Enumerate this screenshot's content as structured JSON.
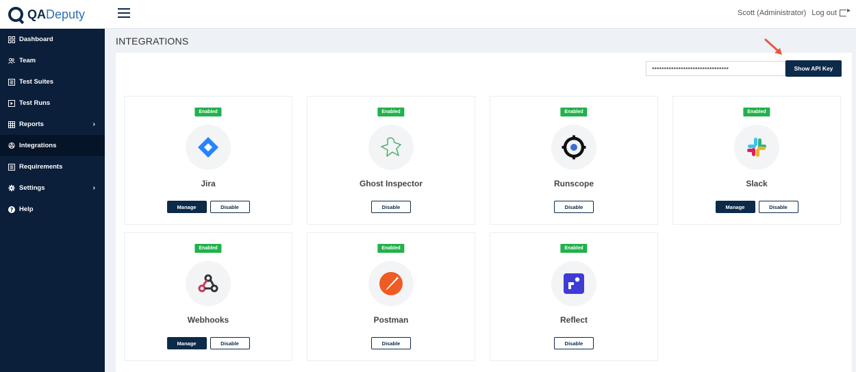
{
  "brand": {
    "name_bold": "QA",
    "name_regular": "Deputy"
  },
  "header": {
    "user_label": "Scott (Administrator)",
    "logout_label": "Log out"
  },
  "sidebar": {
    "items": [
      {
        "label": "Dashboard",
        "icon": "dashboard-grid-icon"
      },
      {
        "label": "Team",
        "icon": "team-icon"
      },
      {
        "label": "Test Suites",
        "icon": "list-icon"
      },
      {
        "label": "Test Runs",
        "icon": "play-icon"
      },
      {
        "label": "Reports",
        "icon": "table-icon",
        "has_chevron": true
      },
      {
        "label": "Integrations",
        "icon": "integrations-icon",
        "active": true
      },
      {
        "label": "Requirements",
        "icon": "list-icon"
      },
      {
        "label": "Settings",
        "icon": "gear-icon",
        "has_chevron": true
      },
      {
        "label": "Help",
        "icon": "help-icon"
      }
    ]
  },
  "main": {
    "title": "INTEGRATIONS",
    "api_key": {
      "masked_value": "••••••••••••••••••••••••••••••••",
      "button_label": "Show API Key"
    },
    "integrations": [
      {
        "name": "Jira",
        "status": "Enabled",
        "manage_label": "Manage",
        "disable_label": "Disable",
        "icon": "jira-icon"
      },
      {
        "name": "Ghost Inspector",
        "status": "Enabled",
        "disable_label": "Disable",
        "icon": "ghost-icon"
      },
      {
        "name": "Runscope",
        "status": "Enabled",
        "disable_label": "Disable",
        "icon": "runscope-icon"
      },
      {
        "name": "Slack",
        "status": "Enabled",
        "manage_label": "Manage",
        "disable_label": "Disable",
        "icon": "slack-icon"
      },
      {
        "name": "Webhooks",
        "status": "Enabled",
        "manage_label": "Manage",
        "disable_label": "Disable",
        "icon": "webhooks-icon"
      },
      {
        "name": "Postman",
        "status": "Enabled",
        "disable_label": "Disable",
        "icon": "postman-icon"
      },
      {
        "name": "Reflect",
        "status": "Enabled",
        "disable_label": "Disable",
        "icon": "reflect-icon"
      }
    ]
  },
  "colors": {
    "sidebar_bg": "#0b1f3b",
    "primary": "#0c2a4a",
    "enabled_badge": "#22b14c",
    "arrow": "#e8573f"
  }
}
